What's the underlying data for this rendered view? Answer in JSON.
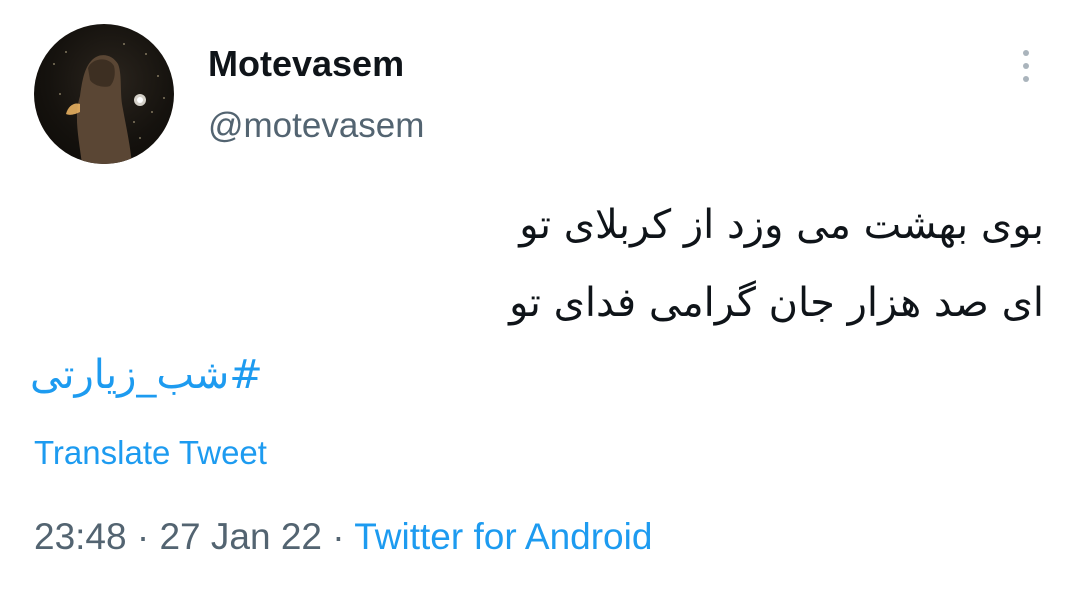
{
  "user": {
    "display_name": "Motevasem",
    "handle": "@motevasem"
  },
  "tweet": {
    "lines": [
      "بوی بهشت می وزد از کربلای تو",
      "ای صد هزار جان گرامی فدای تو"
    ],
    "hashtag": "#شب_زیارتی",
    "translate_label": "Translate Tweet"
  },
  "meta": {
    "time": "23:48",
    "separator": "·",
    "date": "27 Jan 22",
    "source": "Twitter for Android"
  },
  "icons": {
    "more": "more-vertical-icon"
  },
  "colors": {
    "link": "#1d9bf0",
    "text": "#0f1419",
    "secondary": "#536471"
  }
}
